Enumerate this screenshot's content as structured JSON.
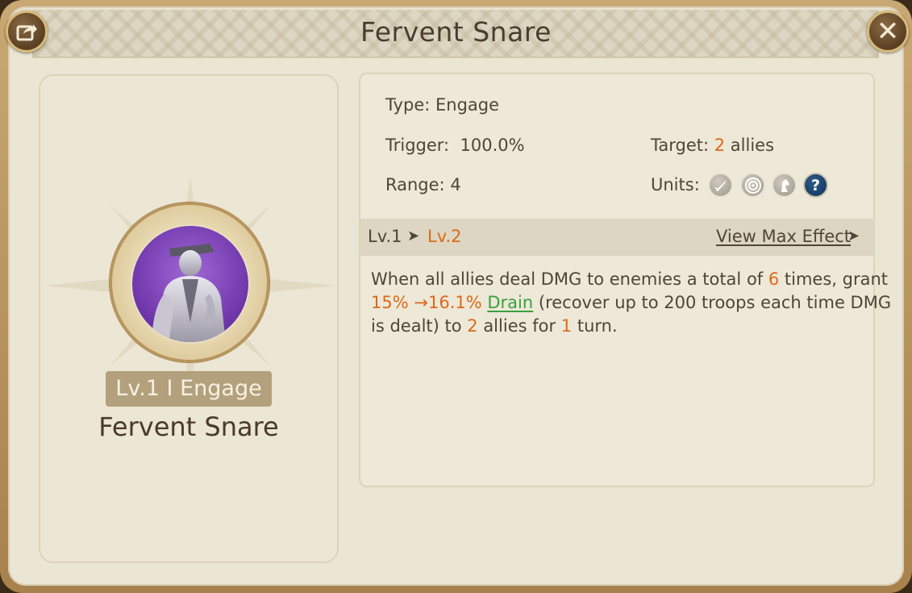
{
  "window": {
    "title": "Fervent Snare"
  },
  "skill": {
    "badge": "Lv.1 I Engage",
    "name": "Fervent Snare"
  },
  "stats": {
    "type_label": "Type:",
    "type_value": "Engage",
    "trigger_label": "Trigger:",
    "trigger_value": "100.0%",
    "target_label": "Target:",
    "target_count": "2",
    "target_unit": "allies",
    "range_label": "Range:",
    "range_value": "4",
    "units_label": "Units:",
    "unit_icons": [
      "infantry-sword-icon",
      "archer-target-icon",
      "cavalry-horse-icon",
      "question-mark-icon"
    ]
  },
  "levels": {
    "current": "Lv.1",
    "next": "Lv.2",
    "view_max": "View Max Effect"
  },
  "description": {
    "line1_a": "When all allies deal DMG to enemies a total of ",
    "times_count": "6",
    "line1_b": " times, grant",
    "pct_from": "15%",
    "pct_arrow": " →",
    "pct_to": "16.1%",
    "drain_link": "Drain",
    "line2_b": " (recover up to 200 troops each time DMG",
    "line3_a": "is dealt) to ",
    "allies_count": "2",
    "line3_b": " allies for ",
    "turn_count": "1",
    "line3_c": " turn."
  },
  "colors": {
    "highlight": "#dc6a1a",
    "link_green": "#3aa040",
    "text": "#4f4538",
    "panel": "#ebe5d3",
    "frame_gold": "#b8915a"
  }
}
